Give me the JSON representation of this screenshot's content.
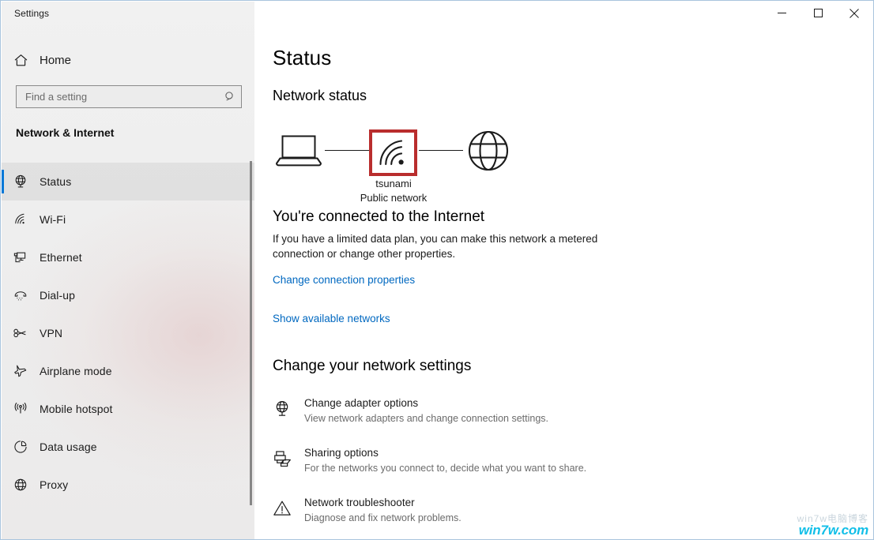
{
  "window": {
    "title": "Settings",
    "controls": {
      "minimize": "minimize-icon",
      "maximize": "maximize-icon",
      "close": "close-icon"
    }
  },
  "sidebar": {
    "home": {
      "label": "Home",
      "icon": "home-icon"
    },
    "search": {
      "placeholder": "Find a setting",
      "value": "",
      "icon": "search-icon"
    },
    "category": "Network & Internet",
    "items": [
      {
        "label": "Status",
        "icon": "status-globe-icon",
        "selected": true
      },
      {
        "label": "Wi-Fi",
        "icon": "wifi-icon",
        "selected": false
      },
      {
        "label": "Ethernet",
        "icon": "ethernet-icon",
        "selected": false
      },
      {
        "label": "Dial-up",
        "icon": "dialup-icon",
        "selected": false
      },
      {
        "label": "VPN",
        "icon": "vpn-icon",
        "selected": false
      },
      {
        "label": "Airplane mode",
        "icon": "airplane-icon",
        "selected": false
      },
      {
        "label": "Mobile hotspot",
        "icon": "hotspot-icon",
        "selected": false
      },
      {
        "label": "Data usage",
        "icon": "data-usage-icon",
        "selected": false
      },
      {
        "label": "Proxy",
        "icon": "proxy-globe-icon",
        "selected": false
      }
    ],
    "accent_color": "#0078d7"
  },
  "main": {
    "page_title": "Status",
    "network_status_heading": "Network status",
    "diagram": {
      "device_icon": "laptop-icon",
      "network_icon": "wifi-signal-icon",
      "internet_icon": "globe-icon",
      "network_name": "tsunami",
      "network_type": "Public network",
      "highlight_color": "#b92d2d"
    },
    "connection": {
      "headline": "You're connected to the Internet",
      "description": "If you have a limited data plan, you can make this network a metered connection or change other properties.",
      "link_change_properties": "Change connection properties",
      "link_show_networks": "Show available networks",
      "link_color": "#0068c0"
    },
    "change_settings_heading": "Change your network settings",
    "settings": [
      {
        "title": "Change adapter options",
        "subtitle": "View network adapters and change connection settings.",
        "icon": "adapter-globe-icon"
      },
      {
        "title": "Sharing options",
        "subtitle": "For the networks you connect to, decide what you want to share.",
        "icon": "sharing-icon"
      },
      {
        "title": "Network troubleshooter",
        "subtitle": "Diagnose and fix network problems.",
        "icon": "warning-triangle-icon"
      }
    ]
  },
  "watermark": {
    "overlay_text": "win7w电脑博客",
    "text": "win7w.com",
    "color": "#12bfe8"
  }
}
